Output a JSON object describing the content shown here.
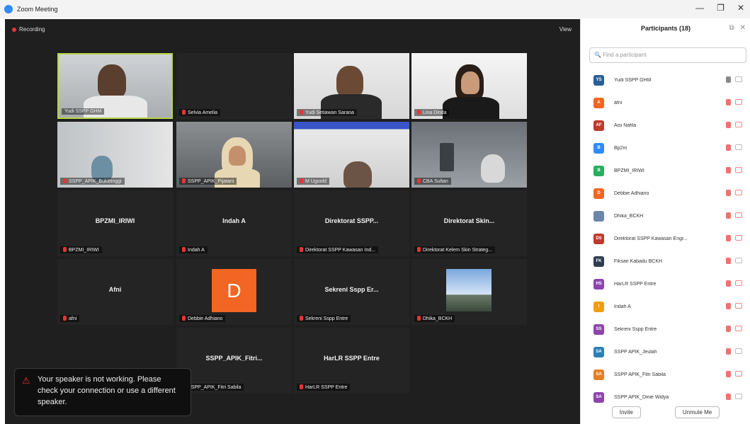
{
  "window": {
    "title": "Zoom Meeting",
    "controls": [
      "—",
      "❐",
      "✕"
    ]
  },
  "stage": {
    "recording_label": "Recording",
    "view_label": "View"
  },
  "tiles": [
    {
      "label": "Yudi SSPP GHM",
      "active": true,
      "kind": "video"
    },
    {
      "label": "Selvia Amelia",
      "kind": "blank"
    },
    {
      "label": "Yudi Setiawan Sarana",
      "kind": "video"
    },
    {
      "label": "Lina Dinda",
      "kind": "video"
    },
    {
      "label": "SSPP_APIK_Bukittinggi",
      "kind": "video"
    },
    {
      "label": "SSPP_APIK_Pijatani",
      "kind": "video"
    },
    {
      "label": "M Ugoold",
      "kind": "video"
    },
    {
      "label": "CBA Sultan",
      "kind": "video"
    },
    {
      "center": "BPZMI_IRIWI",
      "label": "BPZMI_IRIWI",
      "kind": "name"
    },
    {
      "center": "Indah A",
      "label": "Indah A",
      "kind": "name"
    },
    {
      "center": "Direktorat SSPP...",
      "label": "Direktorat SSPP Kawasan Ind...",
      "kind": "name"
    },
    {
      "center": "Direktorat Skin...",
      "label": "Direktorat Kelem Skin Strateg...",
      "kind": "name"
    },
    {
      "center": "Afni",
      "label": "afni",
      "kind": "name"
    },
    {
      "avatar_letter": "D",
      "label": "Debbie Adhiano",
      "kind": "avatar"
    },
    {
      "center": "Sekreni Sspp Er...",
      "label": "Sekreni Sspp Entre",
      "kind": "name"
    },
    {
      "label": "Dhika_BCKH",
      "kind": "photo"
    },
    {
      "center": "SSPP_APIK_Fitri...",
      "label": "SSPP_APIK_Fitri Sabila",
      "kind": "name"
    },
    {
      "center": "HarLR SSPP Entre",
      "label": "HarLR SSPP Entre",
      "kind": "name"
    }
  ],
  "toast": {
    "message": "Your speaker is not working. Please check your connection or use a different speaker."
  },
  "panel": {
    "title": "Participants (18)",
    "search_placeholder": "Find a participant",
    "participants": [
      {
        "initials": "YS",
        "name": "Yudi SSPP GHM",
        "color": "#2b5e9b",
        "mic_on": true
      },
      {
        "initials": "A",
        "name": "afni",
        "color": "#f26522"
      },
      {
        "initials": "AF",
        "name": "Aisi Nafila",
        "color": "#c0392b"
      },
      {
        "initials": "B",
        "name": "Bp2m",
        "color": "#2d8cff"
      },
      {
        "initials": "B",
        "name": "BPZMI_IRIWI",
        "color": "#27ae60"
      },
      {
        "initials": "D",
        "name": "Debbie Adhiano",
        "color": "#f26522"
      },
      {
        "initials": "",
        "name": "Dhika_BCKH",
        "color": "#6b86a8"
      },
      {
        "initials": "DS",
        "name": "Direktorat SSPP Kawasan Engr...",
        "color": "#c0392b"
      },
      {
        "initials": "FK",
        "name": "Fiksari Kabadu BCKH",
        "color": "#2c3e50"
      },
      {
        "initials": "HS",
        "name": "HarLR SSPP Entre",
        "color": "#8e44ad"
      },
      {
        "initials": "I",
        "name": "Indah A",
        "color": "#f39c12"
      },
      {
        "initials": "SS",
        "name": "Sekreni Sspp Entre",
        "color": "#8e44ad"
      },
      {
        "initials": "SA",
        "name": "SSPP APIK_Jeulah",
        "color": "#2980b9"
      },
      {
        "initials": "SA",
        "name": "SSPP APIK_Fitri Sabila",
        "color": "#e67e22"
      },
      {
        "initials": "SA",
        "name": "SSPP APIK_Dinie Widya",
        "color": "#8e44ad"
      }
    ],
    "invite_label": "Invite",
    "unmute_label": "Unmute Me"
  }
}
